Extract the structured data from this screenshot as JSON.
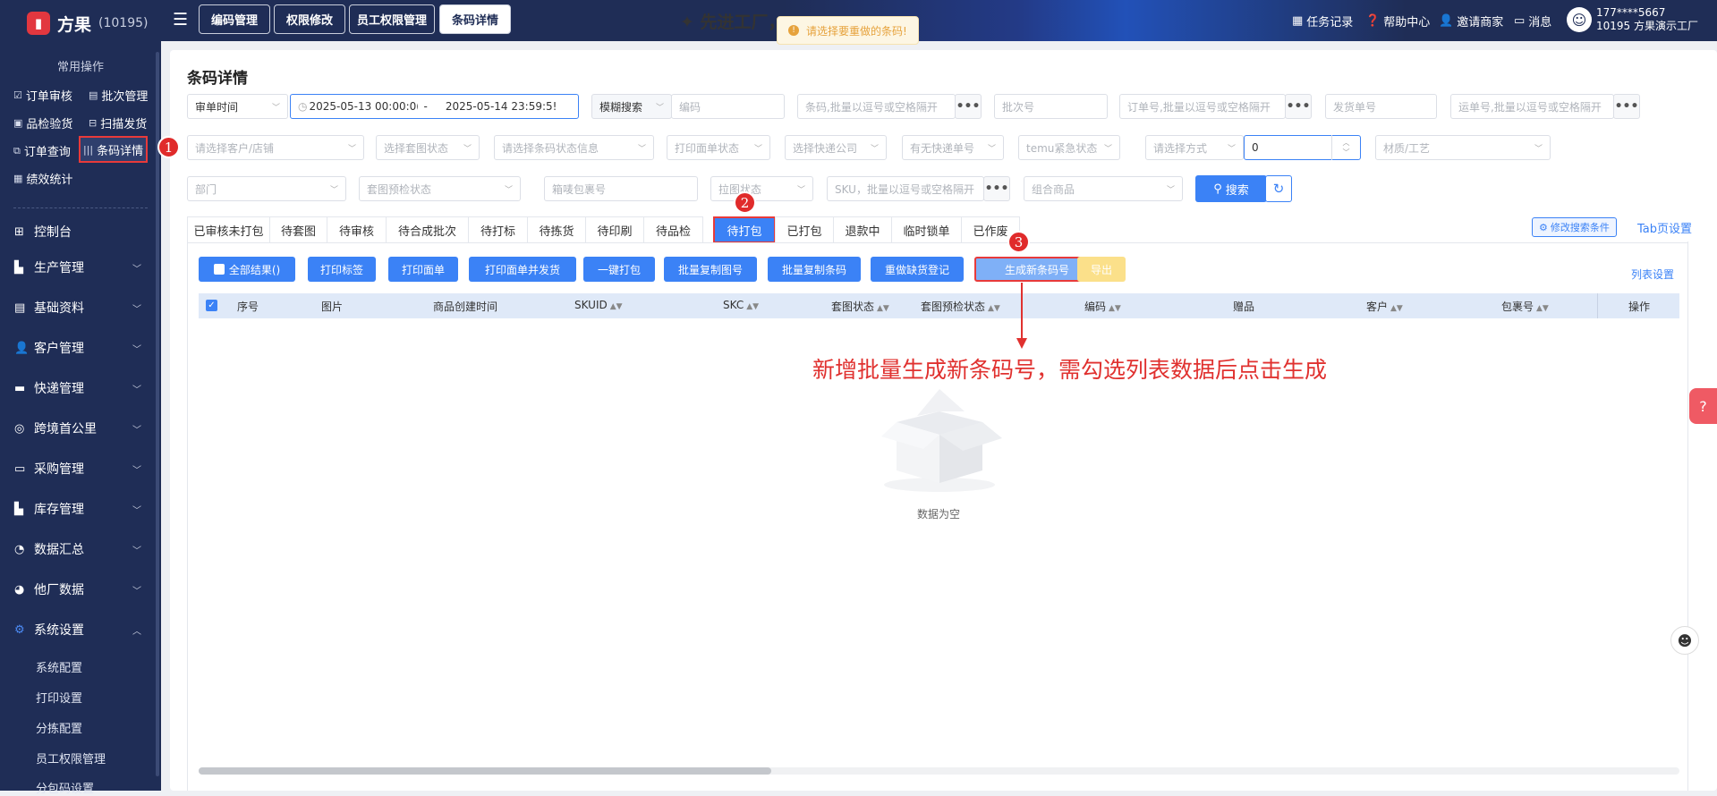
{
  "app": {
    "name": "方果",
    "code": "(10195)"
  },
  "sidebar": {
    "quick_title": "常用操作",
    "quick": [
      {
        "label": "订单审核",
        "icon": "check-square-icon"
      },
      {
        "label": "批次管理",
        "icon": "file-icon"
      },
      {
        "label": "品检验货",
        "icon": "box-icon"
      },
      {
        "label": "扫描发货",
        "icon": "scan-icon"
      },
      {
        "label": "订单查询",
        "icon": "search-doc-icon"
      },
      {
        "label": "条码详情",
        "icon": "barcode-icon"
      },
      {
        "label": "绩效统计",
        "icon": "chart-icon"
      }
    ],
    "nav": [
      {
        "label": "控制台"
      },
      {
        "label": "生产管理"
      },
      {
        "label": "基础资料"
      },
      {
        "label": "客户管理"
      },
      {
        "label": "快递管理"
      },
      {
        "label": "跨境首公里"
      },
      {
        "label": "采购管理"
      },
      {
        "label": "库存管理"
      },
      {
        "label": "数据汇总"
      },
      {
        "label": "他厂数据"
      },
      {
        "label": "系统设置"
      }
    ],
    "sub": [
      "系统配置",
      "打印设置",
      "分拣配置",
      "员工权限管理",
      "分包码设置"
    ]
  },
  "topbar": {
    "tabs": [
      "编码管理",
      "权限修改",
      "员工权限管理",
      "条码详情"
    ],
    "slogan": "✦ 先进工厂，",
    "toast": "请选择要重做的条码!",
    "links": [
      "任务记录",
      "帮助中心",
      "邀请商家",
      "消息"
    ],
    "user_phone": "177****5667",
    "user_company": "10195 方果演示工厂"
  },
  "page": {
    "title": "条码详情"
  },
  "filters": {
    "row1": {
      "time_type": "审单时间",
      "date_start": "2025-05-13 00:00:0(",
      "date_sep": "-",
      "date_end": "2025-05-14 23:59:5!",
      "search_mode": "模糊搜索",
      "code_ph": "编码",
      "barcode_ph": "条码,批量以逗号或空格隔开",
      "batch_ph": "批次号",
      "order_ph": "订单号,批量以逗号或空格隔开",
      "ship_ph": "发货单号",
      "waybill_ph": "运单号,批量以逗号或空格隔开"
    },
    "row2": {
      "customer_ph": "请选择客户/店铺",
      "tao_ph": "选择套图状态",
      "barcode_status_ph": "请选择条码状态信息",
      "print_status_ph": "打印面单状态",
      "courier_ph": "选择快递公司",
      "has_tracking_ph": "有无快递单号",
      "temu_ph": "temu紧急状态",
      "method_ph": "请选择方式",
      "number_value": "0",
      "material_ph": "材质/工艺"
    },
    "row3": {
      "dept_ph": "部门",
      "tao_check_ph": "套图预检状态",
      "box_ph": "箱唛包裹号",
      "pull_ph": "拉图状态",
      "sku_ph": "SKU，批量以逗号或空格隔开",
      "combo_ph": "组合商品",
      "search_label": "搜索"
    }
  },
  "status_tabs": [
    "已审核未打包",
    "待套图",
    "待审核",
    "待合成批次",
    "待打标",
    "待拣货",
    "待印刷",
    "待品检",
    "待打包",
    "已打包",
    "退款中",
    "临时锁单",
    "已作废"
  ],
  "active_tab": "待打包",
  "modify_search": "修改搜索条件",
  "tab_settings": "Tab页设置",
  "actions": [
    "全部结果()",
    "打印标签",
    "打印面单",
    "打印面单并发货",
    "一键打包",
    "批量复制图号",
    "批量复制条码",
    "重做缺货登记",
    "生成新条码号",
    "导出"
  ],
  "list_settings": "列表设置",
  "columns": [
    "序号",
    "图片",
    "商品创建时间",
    "SKUID",
    "SKC",
    "套图状态",
    "套图预检状态",
    "编码",
    "赠品",
    "客户",
    "包裹号",
    "操作"
  ],
  "empty_text": "数据为空",
  "annotation": "新增批量生成新条码号，需勾选列表数据后点击生成",
  "markers": [
    "1",
    "2",
    "3"
  ],
  "colors": {
    "sidebar": "#1f2d56",
    "primary": "#3b82f6",
    "annotation": "#e0312f",
    "toast": "#e6a23c"
  }
}
